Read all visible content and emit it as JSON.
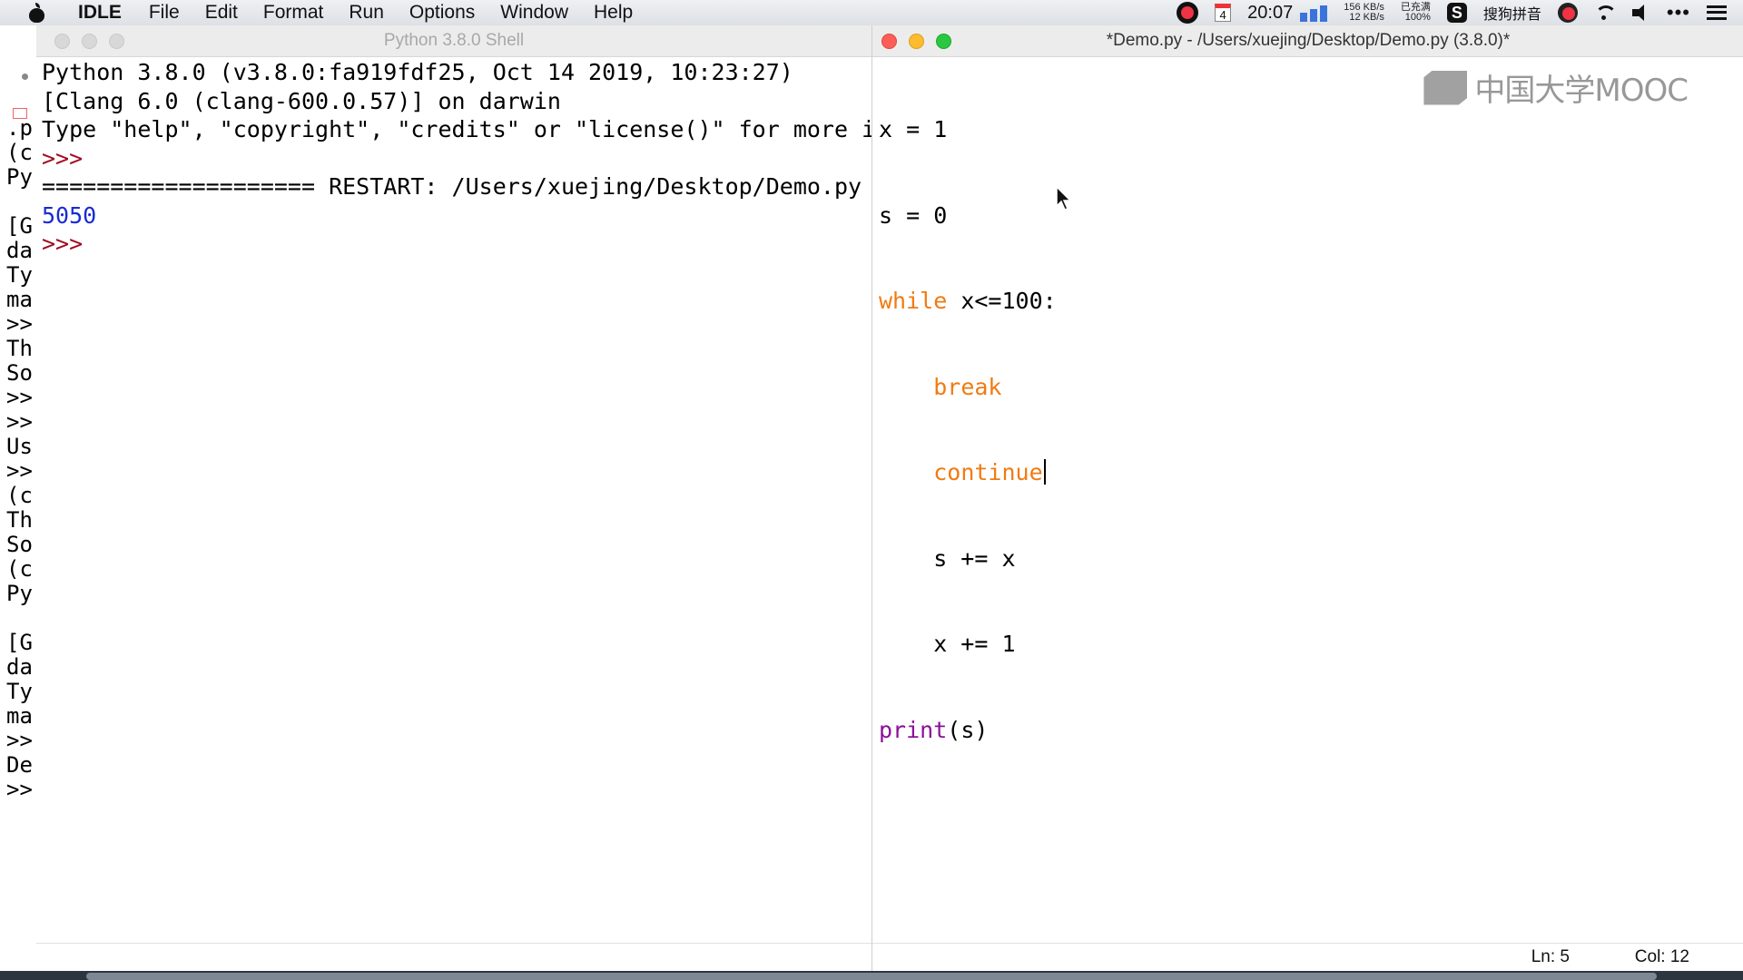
{
  "menubar": {
    "app_name": "IDLE",
    "items": [
      "File",
      "Edit",
      "Format",
      "Run",
      "Options",
      "Window",
      "Help"
    ],
    "calendar_day": "4",
    "time": "20:07",
    "net_up": "156 KB/s",
    "net_down": "12 KB/s",
    "battery_status": "已充满",
    "battery_percent": "100%",
    "input_method": "搜狗拼音",
    "input_method_badge": "S",
    "more_icon_text": "•••"
  },
  "shell_window": {
    "title": "Python 3.8.0 Shell",
    "lines": [
      {
        "text": "Python 3.8.0 (v3.8.0:fa919fdf25, Oct 14 2019, 10:23:27)",
        "style": "black"
      },
      {
        "text": "[Clang 6.0 (clang-600.0.57)] on darwin",
        "style": "black"
      },
      {
        "text": "Type \"help\", \"copyright\", \"credits\" or \"license()\" for more i",
        "style": "black"
      },
      {
        "text": ">>>",
        "style": "prompt"
      },
      {
        "text": "==================== RESTART: /Users/xuejing/Desktop/Demo.py",
        "style": "black"
      },
      {
        "text": "5050",
        "style": "blue"
      },
      {
        "text": ">>>",
        "style": "prompt"
      }
    ]
  },
  "background_shell_fragment": {
    "lines": [
      ".p",
      "(c",
      "Py",
      "",
      "[G",
      "da",
      "Ty",
      "ma",
      ">>",
      "Th",
      "So",
      ">>",
      ">>",
      "Us",
      ">>",
      "(c",
      "Th",
      "So",
      "(c",
      "Py",
      "",
      "[G",
      "da",
      "Ty",
      "ma",
      ">>",
      "De",
      ">>"
    ]
  },
  "editor_window": {
    "title": "*Demo.py - /Users/xuejing/Desktop/Demo.py (3.8.0)*",
    "code": {
      "line1": "x = 1",
      "line2": "s = 0",
      "line3_kw": "while",
      "line3_rest": " x<=100:",
      "line4_indent": "    ",
      "line4_kw": "break",
      "line5_indent": "    ",
      "line5_kw": "continue",
      "line6": "    s += x",
      "line7": "    x += 1",
      "line8_builtin": "print",
      "line8_rest": "(s)"
    },
    "status_line": "Ln: 5",
    "status_col": "Col: 12"
  },
  "watermark": {
    "text": "中国大学MOOC"
  },
  "colors": {
    "keyword": "#f07b12",
    "builtin": "#8c0f9a",
    "prompt": "#a10a20",
    "output": "#1a2bd0"
  }
}
